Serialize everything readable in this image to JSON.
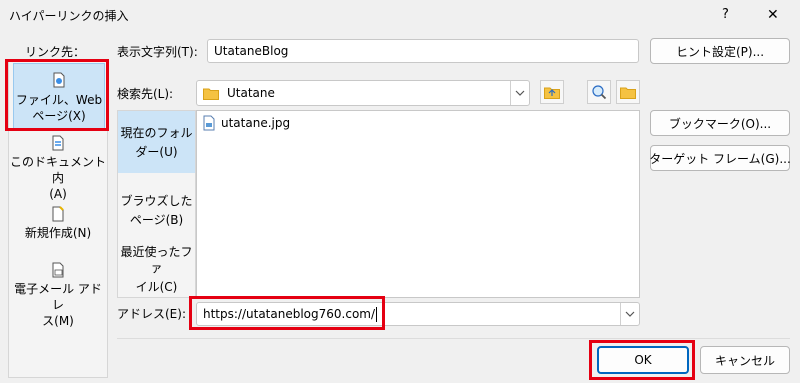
{
  "window": {
    "title": "ハイパーリンクの挿入",
    "help_glyph": "?",
    "close_glyph": "✕"
  },
  "link_to": {
    "label": "リンク先：",
    "items": [
      {
        "line1": "ファイル、Web",
        "line2": "ページ(X)",
        "icon": "globe-document-icon",
        "selected": true
      },
      {
        "line1": "このドキュメント内",
        "line2": "(A)",
        "icon": "document-anchor-icon"
      },
      {
        "line1": "新規作成(N)",
        "icon": "new-document-icon"
      },
      {
        "line1": "電子メール アドレ",
        "line2": "ス(M)",
        "icon": "email-icon"
      }
    ]
  },
  "display_text": {
    "label": "表示文字列(T):",
    "value": "UtataneBlog"
  },
  "screentip_button": "ヒント設定(P)...",
  "look_in": {
    "label": "検索先(L):",
    "value": "Utatane",
    "folder_icon": "folder-icon"
  },
  "browse_buttons": {
    "up_folder": "up-folder-icon",
    "browse_web": "browse-web-icon",
    "browse_file": "browse-folder-icon"
  },
  "location_tabs": [
    {
      "line1": "現在のフォル",
      "line2": "ダー(U)",
      "selected": true
    },
    {
      "line1": "ブラウズした",
      "line2": "ページ(B)"
    },
    {
      "line1": "最近使ったファ",
      "line2": "イル(C)"
    }
  ],
  "file_list": [
    {
      "name": "utatane.jpg",
      "icon": "image-file-icon"
    }
  ],
  "bookmark_button": "ブックマーク(O)...",
  "target_frame_button": "ターゲット フレーム(G)...",
  "address": {
    "label": "アドレス(E):",
    "value": "https://utataneblog760.com/"
  },
  "ok_button": "OK",
  "cancel_button": "キャンセル"
}
